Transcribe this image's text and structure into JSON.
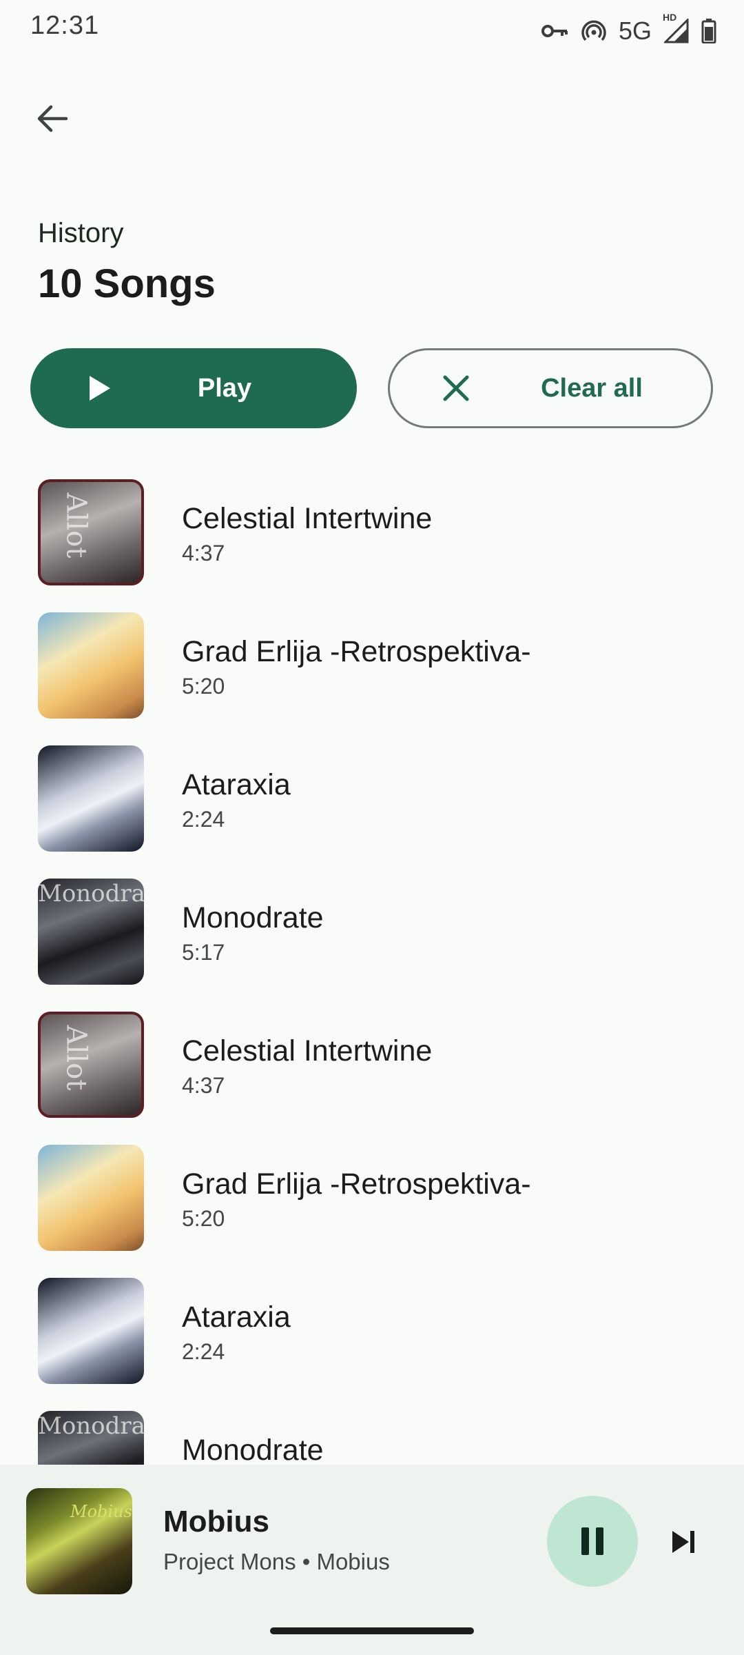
{
  "status_bar": {
    "time": "12:31",
    "network": "5G",
    "network_badge": "HD",
    "icons": [
      "vpn-key-icon",
      "hotspot-icon",
      "signal-icon",
      "battery-icon"
    ]
  },
  "header": {
    "back_icon": "arrow-back-icon",
    "subtitle": "History",
    "title": "10 Songs"
  },
  "actions": {
    "play_label": "Play",
    "play_icon": "play-icon",
    "clear_label": "Clear all",
    "clear_icon": "close-icon"
  },
  "songs": [
    {
      "title": "Celestial Intertwine",
      "duration": "4:37",
      "art": "celestial"
    },
    {
      "title": "Grad Erlija -Retrospektiva-",
      "duration": "5:20",
      "art": "grad"
    },
    {
      "title": "Ataraxia",
      "duration": "2:24",
      "art": "atar"
    },
    {
      "title": "Monodrate",
      "duration": "5:17",
      "art": "mono"
    },
    {
      "title": "Celestial Intertwine",
      "duration": "4:37",
      "art": "celestial"
    },
    {
      "title": "Grad Erlija -Retrospektiva-",
      "duration": "5:20",
      "art": "grad"
    },
    {
      "title": "Ataraxia",
      "duration": "2:24",
      "art": "atar"
    },
    {
      "title": "Monodrate",
      "duration": "",
      "art": "mono"
    }
  ],
  "now_playing": {
    "title": "Mobius",
    "subtitle": "Project Mons • Mobius",
    "art_text": "Mobius",
    "pause_icon": "pause-icon",
    "next_icon": "skip-next-icon"
  },
  "colors": {
    "accent": "#1f6b52",
    "background": "#f9fbf8",
    "player_background": "#eef3ef",
    "pause_button": "#bfe6d2"
  }
}
